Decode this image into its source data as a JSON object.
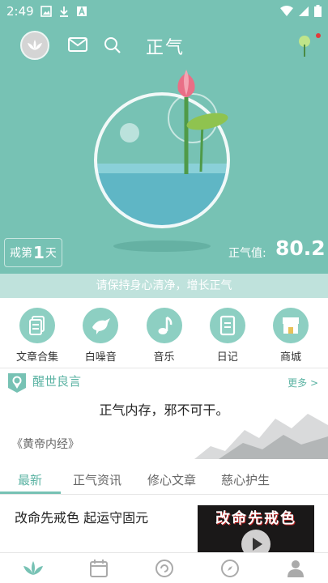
{
  "status_bar": {
    "time": "2:49"
  },
  "header": {
    "title": "正气"
  },
  "counter": {
    "prefix": "戒第",
    "days": "1",
    "suffix": "天"
  },
  "zhengqi": {
    "label": "正气值:",
    "value": "80.2"
  },
  "banner": {
    "text": "请保持身心清净，增长正气"
  },
  "shortcuts": [
    {
      "label": "文章合集",
      "icon": "documents-icon"
    },
    {
      "label": "白噪音",
      "icon": "bird-icon"
    },
    {
      "label": "音乐",
      "icon": "music-note-icon"
    },
    {
      "label": "日记",
      "icon": "diary-icon"
    },
    {
      "label": "商城",
      "icon": "store-icon"
    }
  ],
  "quote": {
    "header": "醒世良言",
    "more": "更多 >",
    "text": "正气内存，邪不可干。",
    "source": "《黄帝内经》"
  },
  "tabs": [
    {
      "label": "最新"
    },
    {
      "label": "正气资讯"
    },
    {
      "label": "修心文章"
    },
    {
      "label": "慈心护生"
    }
  ],
  "article": {
    "title": "改命先戒色 起运守固元",
    "thumb_text": "改命先戒色"
  },
  "bottom_nav": [
    {
      "icon": "lotus-icon"
    },
    {
      "icon": "calendar-icon"
    },
    {
      "icon": "refresh-circle-icon"
    },
    {
      "icon": "compass-icon"
    },
    {
      "icon": "person-icon"
    }
  ],
  "colors": {
    "brand": "#77c2b4",
    "accent_text": "#5bb3a3",
    "banner": "#bfe2dc"
  }
}
